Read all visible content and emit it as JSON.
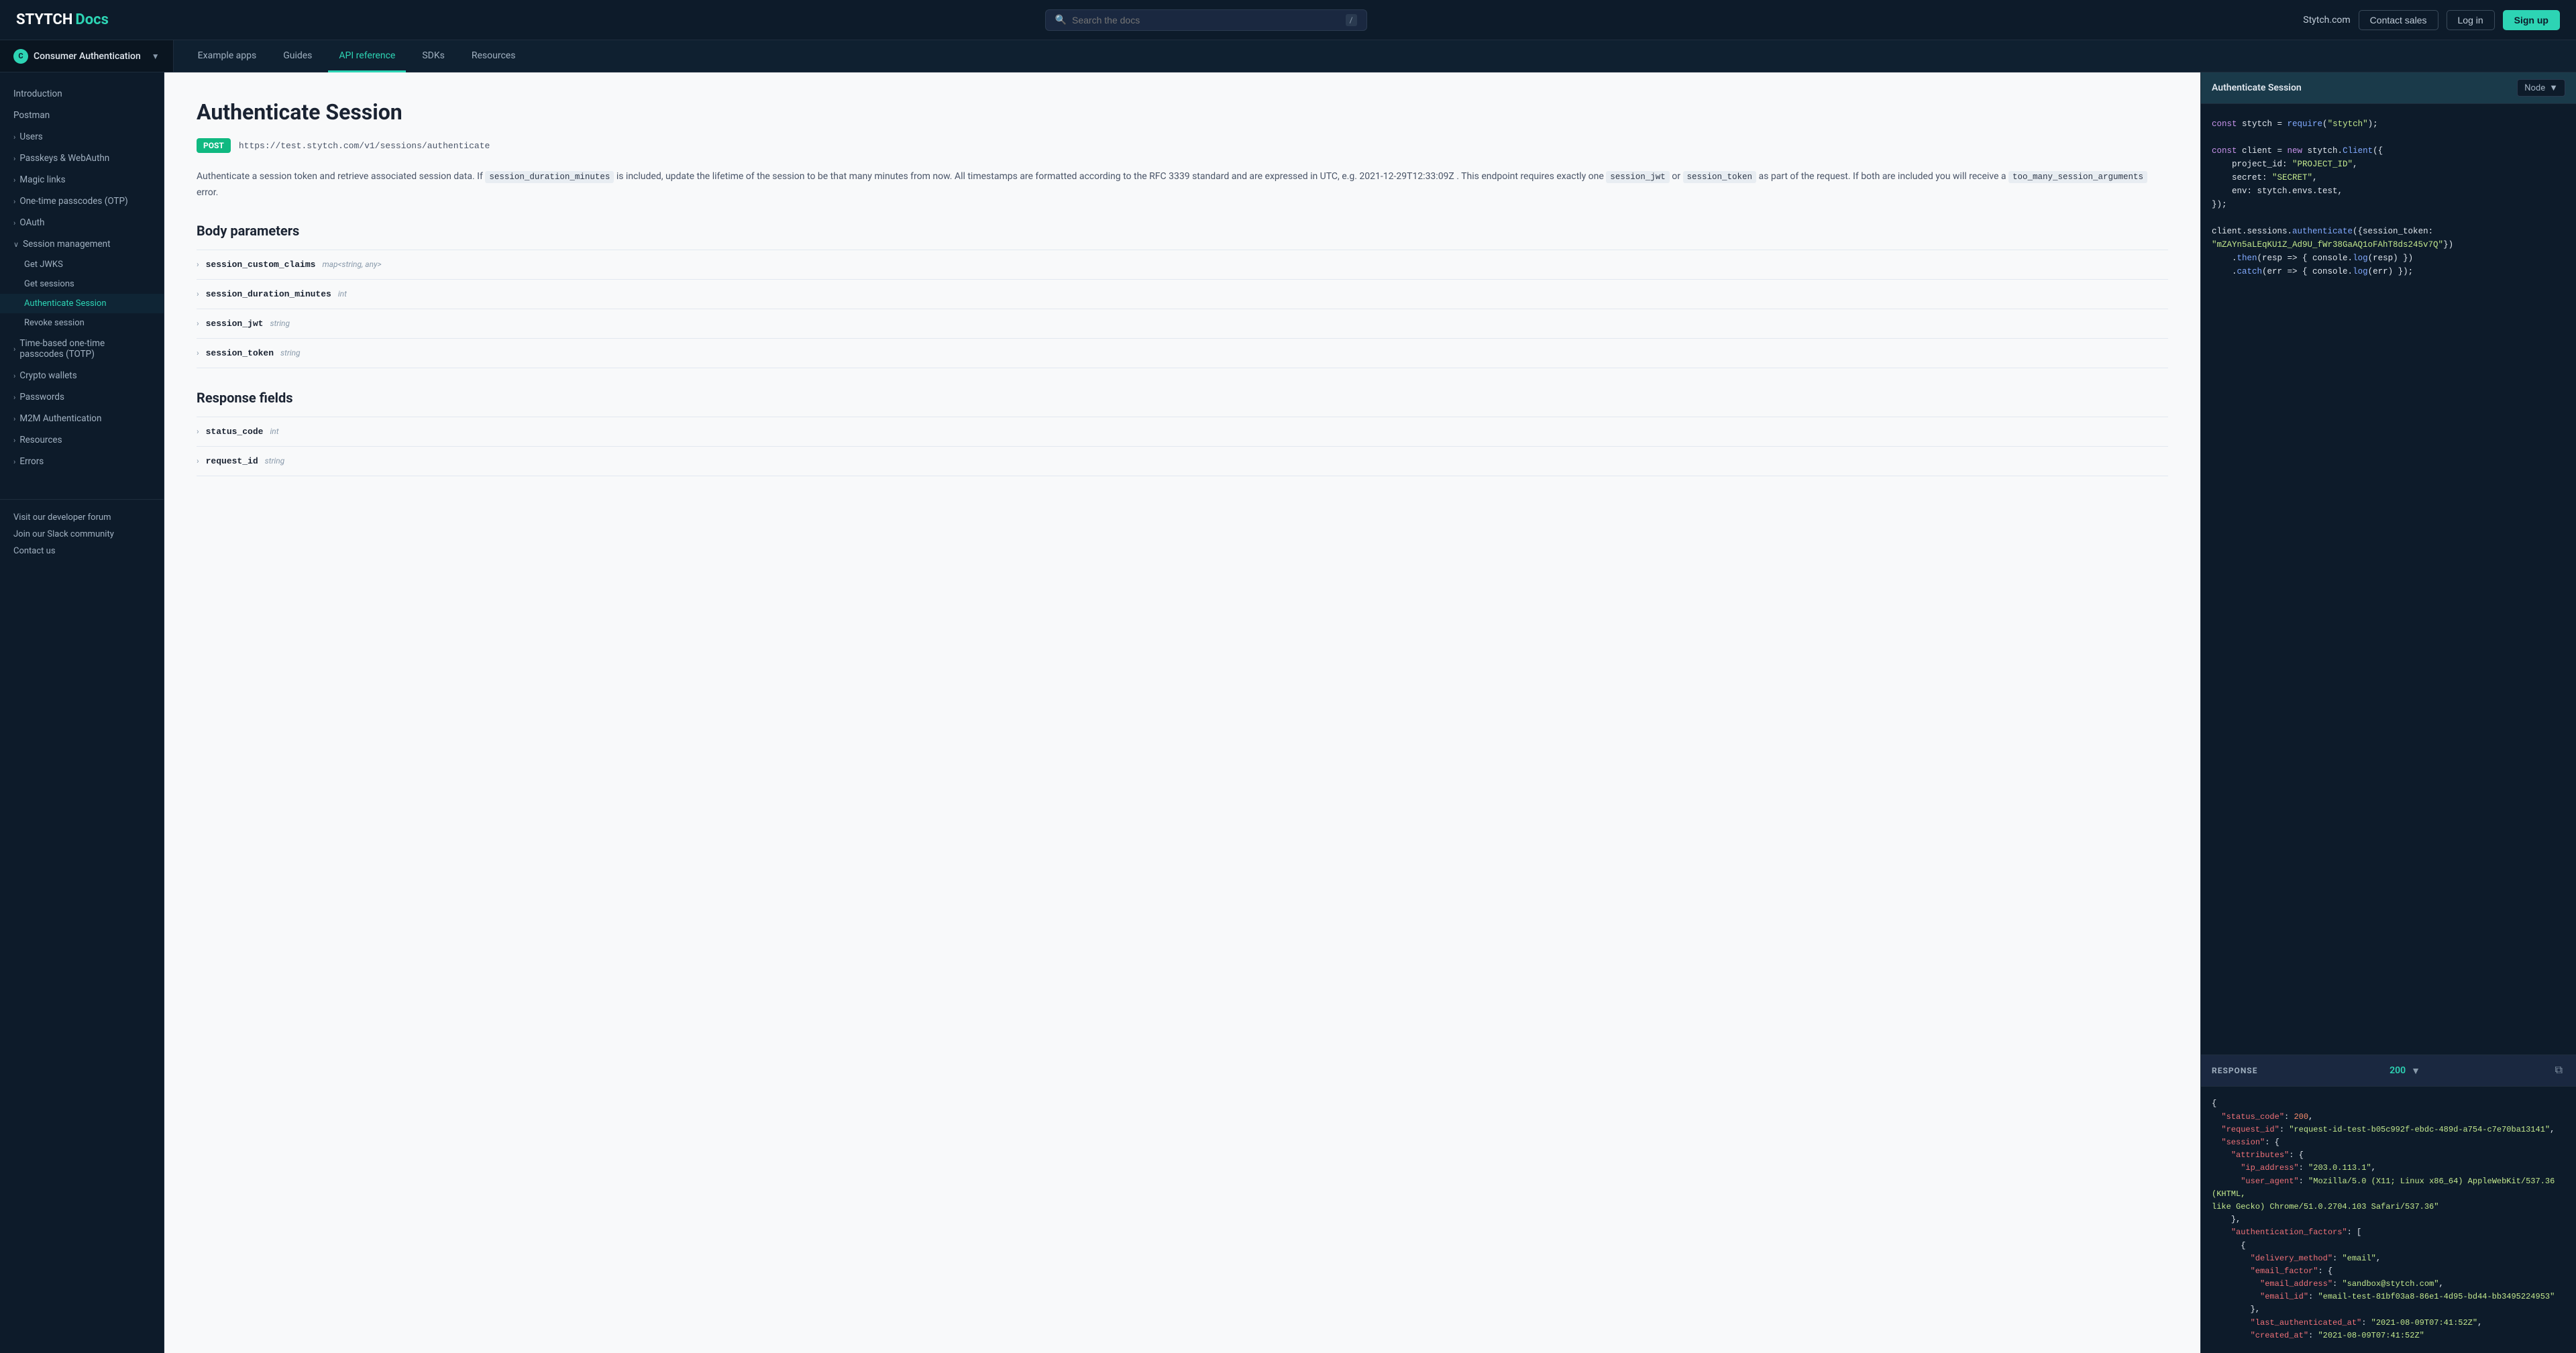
{
  "topbar": {
    "logo_stytch": "STYTCH",
    "logo_docs": "Docs",
    "search_placeholder": "Search the docs",
    "search_shortcut": "/",
    "nav_stytch_com": "Stytch.com",
    "nav_contact_sales": "Contact sales",
    "nav_login": "Log in",
    "nav_signup": "Sign up"
  },
  "section_nav": {
    "selector_label": "Consumer Authentication",
    "items": [
      {
        "label": "Example apps",
        "active": false
      },
      {
        "label": "Guides",
        "active": false
      },
      {
        "label": "API reference",
        "active": true
      },
      {
        "label": "SDKs",
        "active": false
      },
      {
        "label": "Resources",
        "active": false
      }
    ]
  },
  "sidebar": {
    "items": [
      {
        "label": "Introduction",
        "type": "item",
        "indent": 0
      },
      {
        "label": "Postman",
        "type": "item",
        "indent": 0
      },
      {
        "label": "Users",
        "type": "expandable",
        "indent": 0
      },
      {
        "label": "Passkeys & WebAuthn",
        "type": "expandable",
        "indent": 0
      },
      {
        "label": "Magic links",
        "type": "expandable",
        "indent": 0
      },
      {
        "label": "One-time passcodes (OTP)",
        "type": "expandable",
        "indent": 0
      },
      {
        "label": "OAuth",
        "type": "expandable",
        "indent": 0
      },
      {
        "label": "Session management",
        "type": "expandable",
        "indent": 0,
        "expanded": true
      },
      {
        "label": "Get JWKS",
        "type": "subitem",
        "indent": 1
      },
      {
        "label": "Get sessions",
        "type": "subitem",
        "indent": 1
      },
      {
        "label": "Authenticate Session",
        "type": "subitem",
        "indent": 1,
        "active": true
      },
      {
        "label": "Revoke session",
        "type": "subitem",
        "indent": 1
      },
      {
        "label": "Time-based one-time passcodes (TOTP)",
        "type": "expandable",
        "indent": 0
      },
      {
        "label": "Crypto wallets",
        "type": "expandable",
        "indent": 0
      },
      {
        "label": "Passwords",
        "type": "expandable",
        "indent": 0
      },
      {
        "label": "M2M Authentication",
        "type": "expandable",
        "indent": 0
      },
      {
        "label": "Resources",
        "type": "expandable",
        "indent": 0
      },
      {
        "label": "Errors",
        "type": "expandable",
        "indent": 0
      }
    ],
    "bottom_links": [
      "Visit our developer forum",
      "Join our Slack community",
      "Contact us"
    ]
  },
  "main": {
    "page_title": "Authenticate Session",
    "method": "POST",
    "endpoint_url": "https://test.stytch.com/v1/sessions/authenticate",
    "description": "Authenticate a session token and retrieve associated session data. If session_duration_minutes is included, update the lifetime of the session to be that many minutes from now. All timestamps are formatted according to the RFC 3339 standard and are expressed in UTC, e.g. 2021-12-29T12:33:09Z . This endpoint requires exactly one session_jwt or session_token as part of the request. If both are included you will receive a too_many_session_arguments error.",
    "body_params_title": "Body parameters",
    "params": [
      {
        "name": "session_custom_claims",
        "type": "map<string, any>"
      },
      {
        "name": "session_duration_minutes",
        "type": "int"
      },
      {
        "name": "session_jwt",
        "type": "string"
      },
      {
        "name": "session_token",
        "type": "string"
      }
    ],
    "response_fields_title": "Response fields",
    "response_fields": [
      {
        "name": "status_code",
        "type": "int"
      },
      {
        "name": "request_id",
        "type": "string"
      }
    ]
  },
  "code_panel": {
    "title": "Authenticate Session",
    "language": "Node",
    "code_lines": [
      "const stytch = require(\"stytch\");",
      "",
      "const client = new stytch.Client({",
      "    project_id: \"PROJECT_ID\",",
      "    secret: \"SECRET\",",
      "    env: stytch.envs.test,",
      "});",
      "",
      "client.sessions.authenticate({session_token:",
      "\"mZAYn5aLEqKU1Z_Ad9U_fWr38GaAQ1oFAhT8ds245v7Q\"})",
      "    .then(resp => { console.log(resp) })",
      "    .catch(err => { console.log(err) });"
    ]
  },
  "response_panel": {
    "label": "RESPONSE",
    "status": "200",
    "json": [
      "{",
      "  \"status_code\": 200,",
      "  \"request_id\": \"request-id-test-b05c992f-ebdc-489d-a754-c7e70ba13141\",",
      "  \"session\": {",
      "    \"attributes\": {",
      "      \"ip_address\": \"203.0.113.1\",",
      "      \"user_agent\": \"Mozilla/5.0 (X11; Linux x86_64) AppleWebKit/537.36 (KHTML, like Gecko) Chrome/51.0.2704.103 Safari/537.36\"",
      "    },",
      "    \"authentication_factors\": [",
      "      {",
      "        \"delivery_method\": \"email\",",
      "        \"email_factor\": {",
      "          \"email_address\": \"sandbox@stytch.com\",",
      "          \"email_id\": \"email-test-81bf03a8-86e1-4d95-bd44-bb3495224953\"",
      "        },",
      "        \"last_authenticated_at\": \"2021-08-09T07:41:52Z\",",
      "        \"created_at\": \"2021-08-09T07:41:52Z\""
    ]
  }
}
